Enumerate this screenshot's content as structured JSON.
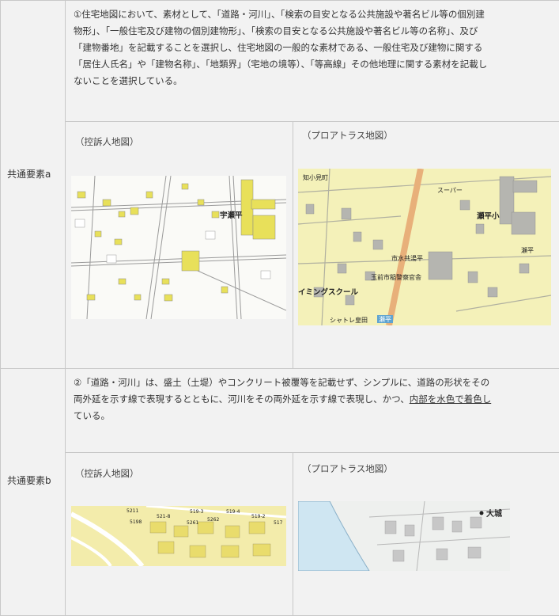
{
  "rows": [
    {
      "label": "共通要素a",
      "description": [
        "①住宅地図において、素材として、「道路・河川」、「検索の目安となる公共施設や著名ビル等の個別建",
        "物形」、「一般住宅及び建物の個別建物形」、「検索の目安となる公共施設や著名ビル等の名称」、及び",
        "「建物番地」を記載することを選択し、住宅地図の一般的な素材である、一般住宅及び建物に関する",
        "「居住人氏名」や「建物名称」、「地類界」（宅地の境等）、「等高線」その他地理に関する素材を記載し",
        "ないことを選択している。"
      ],
      "left_caption": "（控訴人地図）",
      "right_caption": "（プロアトラス地図）",
      "left_map_labels": [
        "宇瀬平"
      ],
      "right_map_labels": [
        "知小見町",
        "スーパー",
        "瀬平小",
        "瀬平",
        "市水共湯平",
        "玉前市稲警察官舎",
        "イミングスクール",
        "シャトレ皇田",
        "瀬平"
      ]
    },
    {
      "label": "共通要素b",
      "description_lines": [
        "②「道路・河川」は、盛土（土堤）やコンクリート被覆等を記載せず、シンプルに、道路の形状をその",
        "両外延を示す線で表現するとともに、河川をその両外延を示す線で表現し、かつ、",
        "ている。"
      ],
      "description_underlined": "内部を水色で着色し",
      "left_caption": "（控訴人地図）",
      "right_caption": "（プロアトラス地図）",
      "left_map_labels": [
        "5211",
        "5198",
        "521-8",
        "519-3",
        "519-4",
        "5261",
        "5262",
        "519-2",
        "517"
      ],
      "right_map_labels": [
        "大城"
      ]
    }
  ],
  "colors": {
    "cell_bg": "#f2f2f2",
    "border": "#c8c8c8",
    "left_map_bg": "#fafaf7",
    "left_map_building": "#e8e05a",
    "right_map_bg": "#f4f1b9",
    "right_map_road": "#e8b07a",
    "river": "#cfe6f2"
  }
}
